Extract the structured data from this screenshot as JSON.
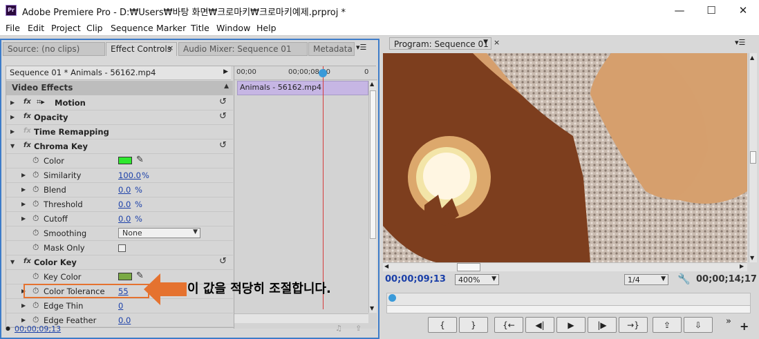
{
  "window": {
    "app_badge": "Pr",
    "title": "Adobe Premiere Pro - D:₩Users₩바탕 화면₩크로마키₩크로마키예제.prproj *",
    "minimize": "—",
    "maximize": "☐",
    "close": "✕"
  },
  "menu": [
    "File",
    "Edit",
    "Project",
    "Clip",
    "Sequence",
    "Marker",
    "Title",
    "Window",
    "Help"
  ],
  "left_tabs": {
    "source": "Source: (no clips)",
    "effect_controls": "Effect Controls",
    "audio_mixer": "Audio Mixer: Sequence 01",
    "metadata": "Metadata"
  },
  "effect_controls": {
    "clip_name": "Sequence 01 * Animals - 56162.mp4",
    "video_effects": "Video Effects",
    "rows": {
      "motion": "Motion",
      "opacity": "Opacity",
      "time_remapping": "Time Remapping",
      "chroma_key": "Chroma Key",
      "color": "Color",
      "similarity": "Similarity",
      "similarity_val": "100.0",
      "blend": "Blend",
      "blend_val": "0.0",
      "threshold": "Threshold",
      "threshold_val": "0.0",
      "cutoff": "Cutoff",
      "cutoff_val": "0.0",
      "smoothing": "Smoothing",
      "smoothing_val": "None",
      "mask_only": "Mask Only",
      "color_key": "Color Key",
      "key_color": "Key Color",
      "color_tolerance": "Color Tolerance",
      "color_tolerance_val": "55",
      "edge_thin": "Edge Thin",
      "edge_thin_val": "0",
      "edge_feather": "Edge Feather",
      "edge_feather_val": "0.0"
    },
    "percent": "%",
    "fx": "fx",
    "timeline": {
      "t0": "00;00",
      "t1": "00;00;08;00",
      "t2": "0",
      "clip": "Animals - 56162.mp4"
    },
    "current_time": "00;00;09;13"
  },
  "colors": {
    "chroma_key_color": "#2ee82e",
    "key_color": "#7aaa44",
    "accent_blue": "#1a3fa8",
    "highlight_orange": "#e5722f"
  },
  "annotation": "이 값을 적당히 조절합니다.",
  "program": {
    "tab": "Program: Sequence 01",
    "timecode": "00;00;09;13",
    "zoom": "400%",
    "resolution": "1/4",
    "duration": "00;00;14;17"
  },
  "controls": [
    "{",
    "}",
    "{←",
    "◀|",
    "▶",
    "|▶",
    "→}",
    "⇪",
    "⇩"
  ]
}
